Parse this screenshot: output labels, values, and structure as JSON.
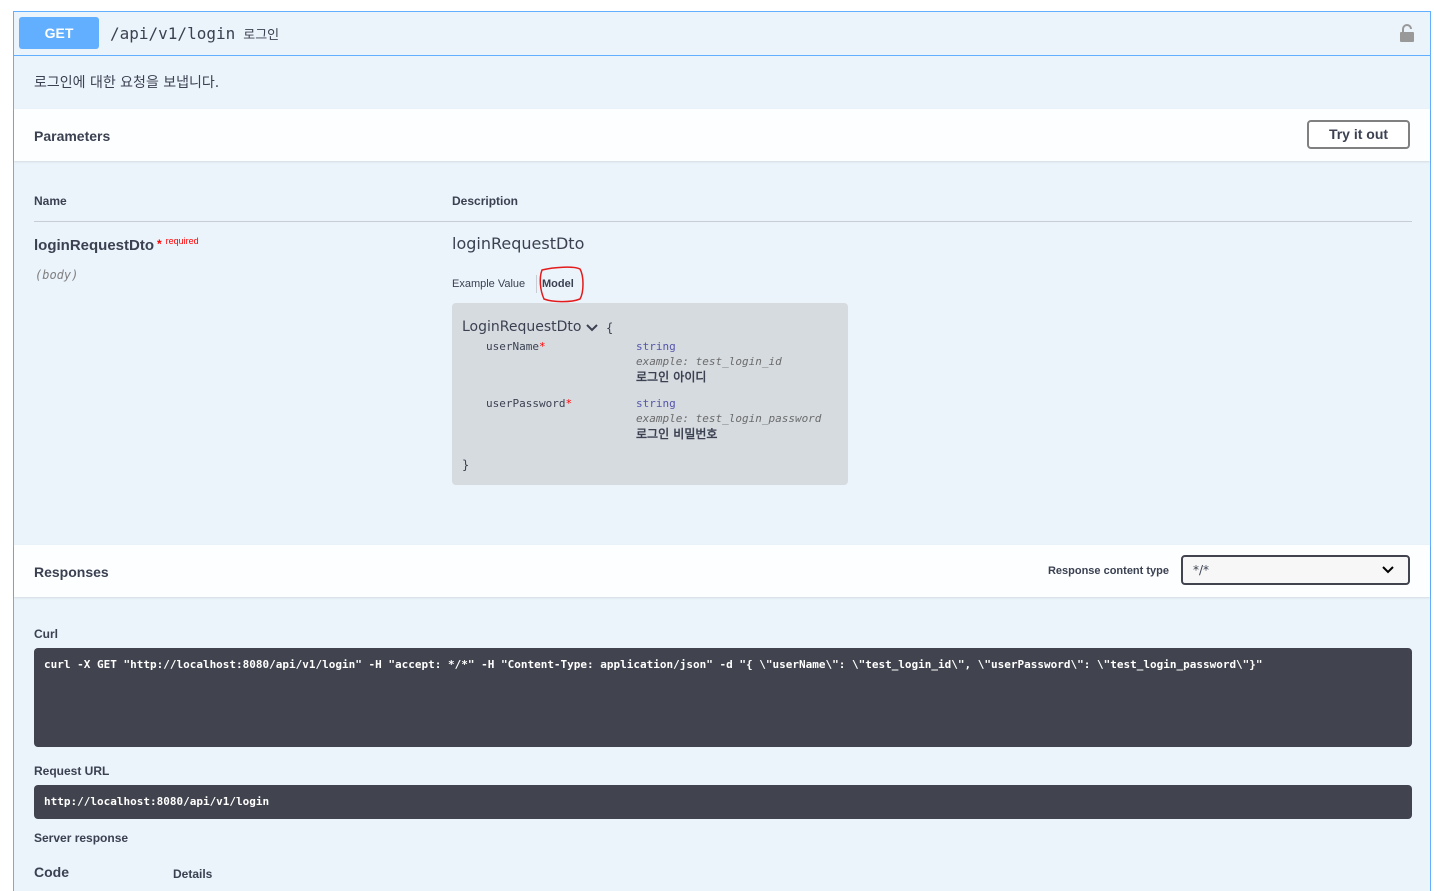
{
  "operation": {
    "method": "GET",
    "path": "/api/v1/login",
    "summary": "로그인",
    "description": "로그인에 대한 요청을 보냅니다.",
    "lock_icon": "lock-icon"
  },
  "parameters": {
    "section_title": "Parameters",
    "try_it_out_label": "Try it out",
    "col_name": "Name",
    "col_description": "Description",
    "param": {
      "name": "loginRequestDto",
      "required_mark": "*",
      "required_label": "required",
      "in": "(body)",
      "schema_name": "loginRequestDto"
    },
    "tabs": {
      "example_value": "Example Value",
      "model": "Model"
    },
    "model": {
      "title": "LoginRequestDto",
      "open_brace": "{",
      "close_brace": "}",
      "properties": [
        {
          "name": "userName",
          "required_mark": "*",
          "type": "string",
          "example": "example: test_login_id",
          "description": "로그인 아이디"
        },
        {
          "name": "userPassword",
          "required_mark": "*",
          "type": "string",
          "example": "example: test_login_password",
          "description": "로그인 비밀번호"
        }
      ]
    }
  },
  "responses": {
    "section_title": "Responses",
    "content_type_label": "Response content type",
    "content_type_value": "*/*",
    "curl_label": "Curl",
    "curl_command": "curl -X GET \"http://localhost:8080/api/v1/login\" -H \"accept: */*\" -H \"Content-Type: application/json\" -d \"{ \\\"userName\\\": \\\"test_login_id\\\", \\\"userPassword\\\": \\\"test_login_password\\\"}\"",
    "request_url_label": "Request URL",
    "request_url": "http://localhost:8080/api/v1/login",
    "server_response_label": "Server response",
    "col_code": "Code",
    "col_details": "Details"
  },
  "colors": {
    "get_accent": "#61affe",
    "background": "#ebf3fb",
    "code_bg": "#41444e",
    "required": "#ff0000"
  }
}
